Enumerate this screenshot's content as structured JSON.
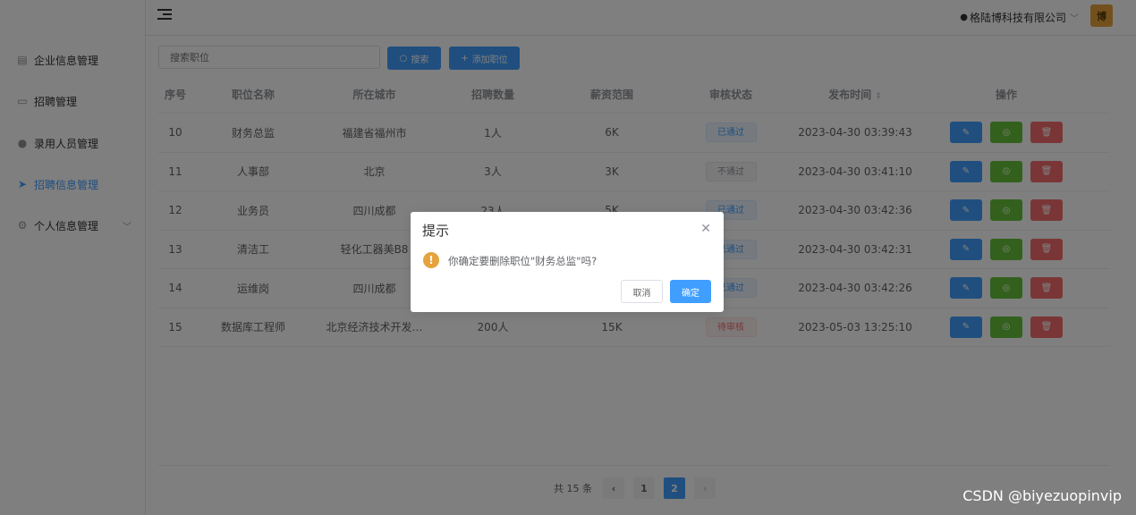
{
  "header": {
    "company": "格陆博科技有限公司",
    "avatar_text": "博"
  },
  "sidebar": {
    "items": [
      {
        "label": "企业信息管理",
        "icon": "building-icon"
      },
      {
        "label": "招聘管理",
        "icon": "briefcase-icon"
      },
      {
        "label": "录用人员管理",
        "icon": "user-icon"
      },
      {
        "label": "招聘信息管理",
        "icon": "send-icon",
        "active": true
      },
      {
        "label": "个人信息管理",
        "icon": "gear-icon"
      }
    ]
  },
  "toolbar": {
    "search_placeholder": "搜索职位",
    "search_label": "搜索",
    "add_label": "添加职位"
  },
  "table": {
    "columns": [
      "序号",
      "职位名称",
      "所在城市",
      "招聘数量",
      "薪资范围",
      "审核状态",
      "发布时间",
      "操作"
    ],
    "rows": [
      {
        "id": "10",
        "name": "财务总监",
        "city": "福建省福州市",
        "count": "1人",
        "salary": "6K",
        "status": "已通过",
        "status_type": "pass",
        "time": "2023-04-30 03:39:43"
      },
      {
        "id": "11",
        "name": "人事部",
        "city": "北京",
        "count": "3人",
        "salary": "3K",
        "status": "不通过",
        "status_type": "fail",
        "time": "2023-04-30 03:41:10"
      },
      {
        "id": "12",
        "name": "业务员",
        "city": "四川成都",
        "count": "23人",
        "salary": "5K",
        "status": "已通过",
        "status_type": "pass",
        "time": "2023-04-30 03:42:36"
      },
      {
        "id": "13",
        "name": "清洁工",
        "city": "轻化工器美B8",
        "count": "",
        "salary": "",
        "status": "已通过",
        "status_type": "pass",
        "time": "2023-04-30 03:42:31"
      },
      {
        "id": "14",
        "name": "运维岗",
        "city": "四川成都",
        "count": "",
        "salary": "",
        "status": "已通过",
        "status_type": "pass",
        "time": "2023-04-30 03:42:26"
      },
      {
        "id": "15",
        "name": "数据库工程师",
        "city": "北京经济技术开发…",
        "count": "200人",
        "salary": "15K",
        "status": "待审核",
        "status_type": "wait",
        "time": "2023-05-03 13:25:10"
      }
    ]
  },
  "pagination": {
    "total": "共 15 条",
    "pages": [
      "1",
      "2"
    ],
    "current": "2"
  },
  "dialog": {
    "title": "提示",
    "message": "你确定要删除职位\"财务总监\"吗?",
    "cancel": "取消",
    "confirm": "确定"
  },
  "watermark": "CSDN @biyezuopinvip",
  "colors": {
    "primary": "#409eff",
    "success": "#67c23a",
    "danger": "#f56c6c",
    "warning": "#e6a23c"
  }
}
